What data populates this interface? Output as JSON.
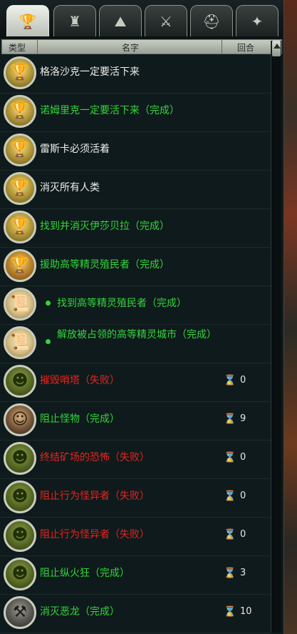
{
  "tabs": [
    {
      "name": "tab-trophy",
      "icon": "trophy-icon",
      "glyph": "🏆"
    },
    {
      "name": "tab-castle",
      "icon": "castle-icon",
      "glyph": "♜"
    },
    {
      "name": "tab-landscape",
      "icon": "landscape-icon",
      "glyph": "⛰"
    },
    {
      "name": "tab-battle",
      "icon": "crossed-swords-icon",
      "glyph": "⚔"
    },
    {
      "name": "tab-helmet",
      "icon": "helmet-icon",
      "glyph": "⛑"
    },
    {
      "name": "tab-compass",
      "icon": "compass-icon",
      "glyph": "✦"
    }
  ],
  "header": {
    "type": "类型",
    "name": "名字",
    "turns": "回合"
  },
  "quests": [
    {
      "badge": "trophy",
      "glyph": "🏆",
      "text": "格洛沙克一定要活下来",
      "color": "white",
      "sub": false,
      "turns": ""
    },
    {
      "badge": "trophy",
      "glyph": "🏆",
      "text": "诺姆里克一定要活下来（完成）",
      "color": "green",
      "sub": false,
      "turns": ""
    },
    {
      "badge": "trophy",
      "glyph": "🏆",
      "text": "雷斯卡必须活着",
      "color": "white",
      "sub": false,
      "turns": ""
    },
    {
      "badge": "trophy",
      "glyph": "🏆",
      "text": "消灭所有人类",
      "color": "white",
      "sub": false,
      "turns": ""
    },
    {
      "badge": "trophy",
      "glyph": "🏆",
      "text": "找到并消灭伊莎贝拉（完成）",
      "color": "green",
      "sub": false,
      "turns": ""
    },
    {
      "badge": "trophy2",
      "glyph": "🏆",
      "text": "援助高等精灵殖民者（完成）",
      "color": "green",
      "sub": false,
      "turns": ""
    },
    {
      "badge": "scroll",
      "glyph": "📜",
      "text": "找到高等精灵殖民者（完成）",
      "color": "green",
      "sub": true,
      "turns": ""
    },
    {
      "badge": "scroll",
      "glyph": "📜",
      "text": "解放被占领的高等精灵城市（完成）",
      "color": "green",
      "sub": true,
      "turns": ""
    },
    {
      "badge": "orc",
      "glyph": "☻",
      "text": "摧毁哨塔（失败）",
      "color": "red",
      "sub": false,
      "turns": "0"
    },
    {
      "badge": "human",
      "glyph": "☺",
      "text": "阻止怪物（完成）",
      "color": "green",
      "sub": false,
      "turns": "9"
    },
    {
      "badge": "orc",
      "glyph": "☻",
      "text": "终结矿场的恐怖（失败）",
      "color": "red",
      "sub": false,
      "turns": "0"
    },
    {
      "badge": "orc",
      "glyph": "☻",
      "text": "阻止行为怪异者（失败）",
      "color": "red",
      "sub": false,
      "turns": "0"
    },
    {
      "badge": "orc",
      "glyph": "☻",
      "text": "阻止行为怪异者（失败）",
      "color": "red",
      "sub": false,
      "turns": "0"
    },
    {
      "badge": "orc",
      "glyph": "☻",
      "text": "阻止纵火狂（完成）",
      "color": "green",
      "sub": false,
      "turns": "3"
    },
    {
      "badge": "dragon",
      "glyph": "⚒",
      "text": "消灭恶龙（完成）",
      "color": "green",
      "sub": false,
      "turns": "10"
    }
  ],
  "hourglass_glyph": "⌛"
}
